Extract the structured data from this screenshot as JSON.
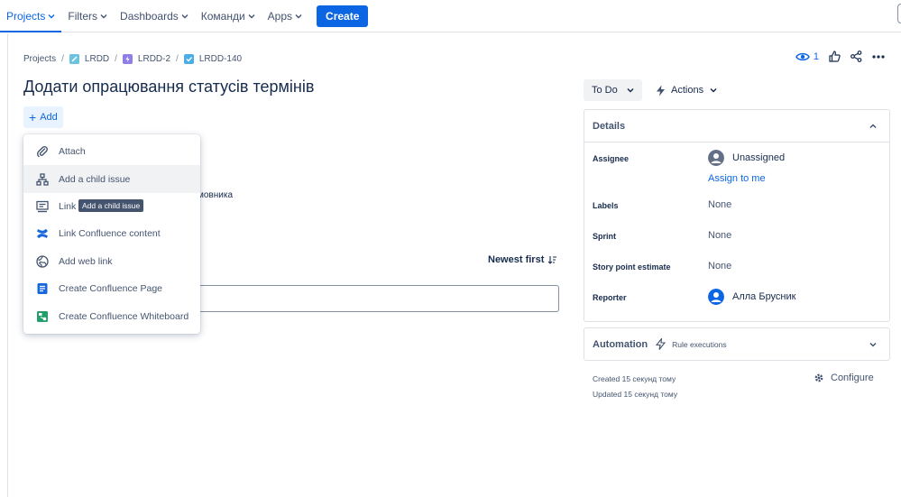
{
  "nav": {
    "projects": "Projects",
    "filters": "Filters",
    "dashboards": "Dashboards",
    "teams": "Команди",
    "apps": "Apps",
    "create": "Create"
  },
  "breadcrumb": {
    "projects": "Projects",
    "project": "LRDD",
    "parent": "LRDD-2",
    "issue": "LRDD-140",
    "sep": "/"
  },
  "watchers": "1",
  "issue": {
    "title": "Додати опрацювання статусів термінів",
    "add_label": "Add"
  },
  "add_menu": {
    "items": [
      {
        "label": "Attach",
        "icon": "paperclip-icon"
      },
      {
        "label": "Add a child issue",
        "icon": "hierarchy-icon"
      },
      {
        "label": "Link",
        "icon": "link-issue-icon"
      },
      {
        "label": "Link Confluence content",
        "icon": "confluence-icon"
      },
      {
        "label": "Add web link",
        "icon": "globe-icon"
      },
      {
        "label": "Create Confluence Page",
        "icon": "page-icon"
      },
      {
        "label": "Create Confluence Whiteboard",
        "icon": "whiteboard-icon"
      }
    ],
    "tooltip": "Add a child issue"
  },
  "background": {
    "partial_text": "мовника",
    "sort_label": "Newest first"
  },
  "status": {
    "current": "To Do",
    "actions": "Actions"
  },
  "details": {
    "heading": "Details",
    "assignee_label": "Assignee",
    "assignee_value": "Unassigned",
    "assign_to_me": "Assign to me",
    "labels_label": "Labels",
    "labels_value": "None",
    "sprint_label": "Sprint",
    "sprint_value": "None",
    "story_points_label": "Story point estimate",
    "story_points_value": "None",
    "reporter_label": "Reporter",
    "reporter_value": "Алла Брусник"
  },
  "automation": {
    "label": "Automation",
    "sub": "Rule executions"
  },
  "meta": {
    "created": "Created 15 секунд тому",
    "updated": "Updated 15 секунд тому",
    "configure": "Configure"
  },
  "colors": {
    "accent": "#0c66e4",
    "text": "#172b4d",
    "subtle": "#44546f",
    "border": "#dfe1e6"
  }
}
